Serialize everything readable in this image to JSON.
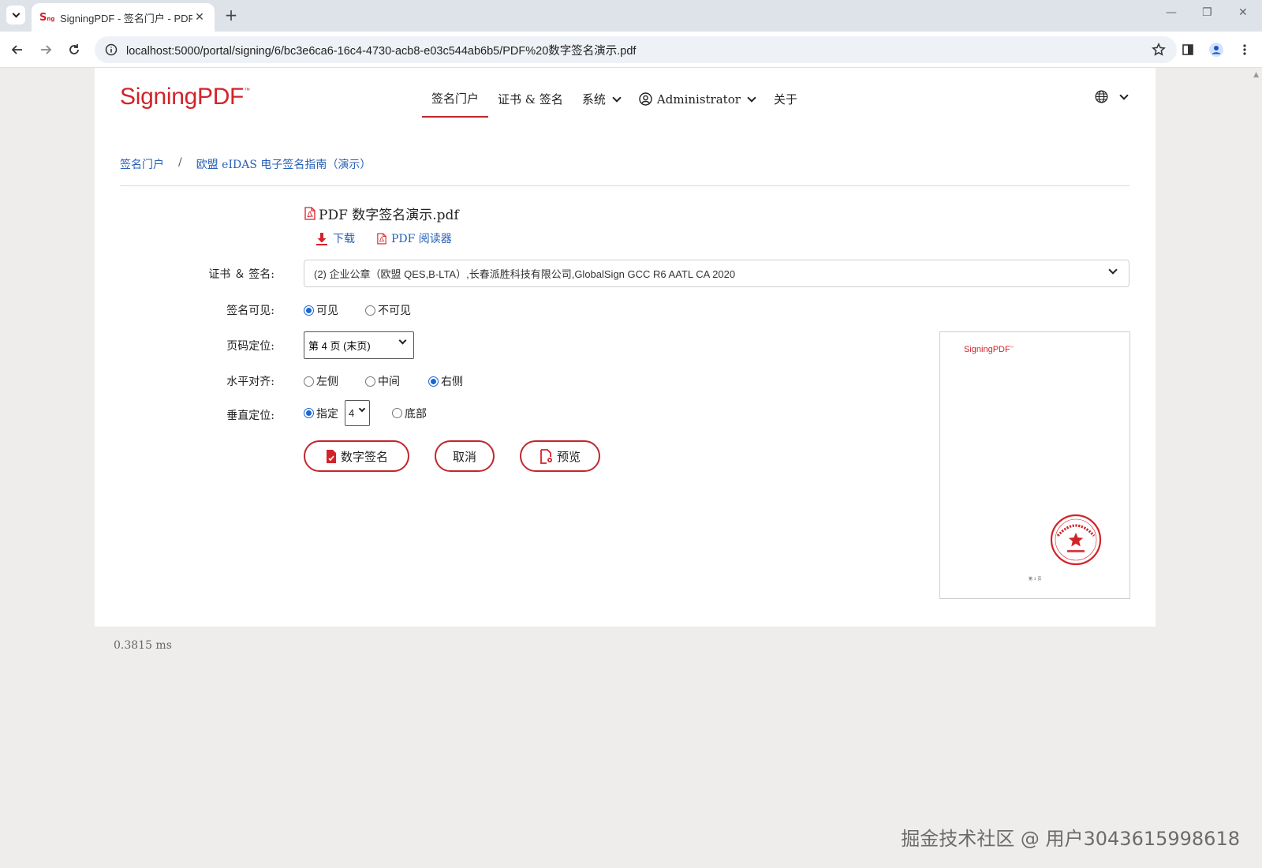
{
  "browser": {
    "tab_title": "SigningPDF - 签名门户 - PDF",
    "tab_favicon": "S",
    "tab_favicon_small": "ng",
    "new_tab": "+",
    "tab_close": "✕",
    "url": "localhost:5000/portal/signing/6/bc3e6ca6-16c4-4730-acb8-e03c544ab6b5/PDF%20数字签名演示.pdf"
  },
  "header": {
    "logo": "SigningPDF",
    "logo_tm": "™",
    "nav": [
      {
        "label": "签名门户",
        "active": true
      },
      {
        "label": "证书 & 签名"
      },
      {
        "label": "系统"
      },
      {
        "label": "Administrator"
      },
      {
        "label": "关于"
      }
    ]
  },
  "breadcrumb": {
    "home": "签名门户",
    "separator": "/",
    "current": "欧盟 eIDAS 电子签名指南（演示）"
  },
  "file": {
    "name": "PDF 数字签名演示.pdf",
    "download": "下载",
    "reader": "PDF 阅读器"
  },
  "form": {
    "cert_label": "证书 ＆ 签名:",
    "cert_value": "(2) 企业公章（欧盟 QES,B-LTA）,长春派胜科技有限公司,GlobalSign GCC R6 AATL CA 2020",
    "visible_label": "签名可见:",
    "visible_options": [
      "可见",
      "不可见"
    ],
    "visible_selected": 0,
    "page_label": "页码定位:",
    "page_value": "第 4 页 (末页)",
    "halign_label": "水平对齐:",
    "halign_options": [
      "左侧",
      "中间",
      "右侧"
    ],
    "halign_selected": 2,
    "valign_label": "垂直定位:",
    "valign_specified": "指定",
    "valign_number": "4",
    "valign_bottom": "底部"
  },
  "buttons": {
    "sign": "数字签名",
    "cancel": "取消",
    "preview": "预览"
  },
  "preview": {
    "logo": "SigningPDF",
    "logo_tm": "™",
    "page_text": "第 1 页"
  },
  "footer": {
    "timing": "0.3815 ms",
    "watermark": "掘金技术社区 @ 用户3043615998618"
  },
  "colors": {
    "brand": "#d2232a",
    "link": "#2860b6",
    "radio": "#1a66d2"
  }
}
